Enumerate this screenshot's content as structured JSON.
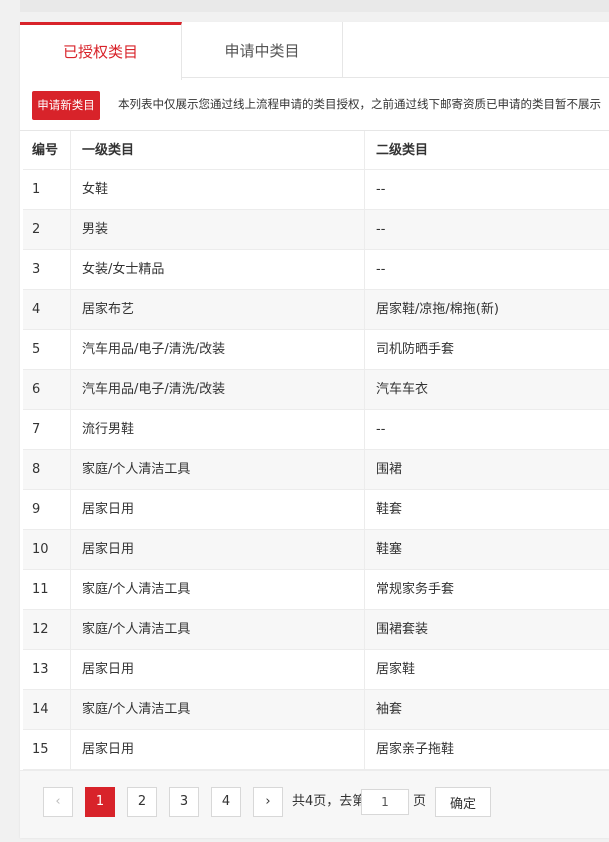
{
  "tabs": {
    "active": "已授权类目",
    "inactive": "申请中类目"
  },
  "notice": {
    "button": "申请新类目",
    "text": "本列表中仅展示您通过线上流程申请的类目授权，之前通过线下邮寄资质已申请的类目暂不展示"
  },
  "table": {
    "headers": [
      "编号",
      "一级类目",
      "二级类目"
    ],
    "rows": [
      {
        "no": "1",
        "level1": "女鞋",
        "level2": "--"
      },
      {
        "no": "2",
        "level1": "男装",
        "level2": "--"
      },
      {
        "no": "3",
        "level1": "女装/女士精品",
        "level2": "--"
      },
      {
        "no": "4",
        "level1": "居家布艺",
        "level2": "居家鞋/凉拖/棉拖(新)"
      },
      {
        "no": "5",
        "level1": "汽车用品/电子/清洗/改装",
        "level2": "司机防晒手套"
      },
      {
        "no": "6",
        "level1": "汽车用品/电子/清洗/改装",
        "level2": "汽车车衣"
      },
      {
        "no": "7",
        "level1": "流行男鞋",
        "level2": "--"
      },
      {
        "no": "8",
        "level1": "家庭/个人清洁工具",
        "level2": "围裙"
      },
      {
        "no": "9",
        "level1": "居家日用",
        "level2": "鞋套"
      },
      {
        "no": "10",
        "level1": "居家日用",
        "level2": "鞋塞"
      },
      {
        "no": "11",
        "level1": "家庭/个人清洁工具",
        "level2": "常规家务手套"
      },
      {
        "no": "12",
        "level1": "家庭/个人清洁工具",
        "level2": "围裙套装"
      },
      {
        "no": "13",
        "level1": "居家日用",
        "level2": "居家鞋"
      },
      {
        "no": "14",
        "level1": "家庭/个人清洁工具",
        "level2": "袖套"
      },
      {
        "no": "15",
        "level1": "居家日用",
        "level2": "居家亲子拖鞋"
      }
    ]
  },
  "pagination": {
    "prev": "‹",
    "next": "›",
    "pages": [
      "1",
      "2",
      "3",
      "4"
    ],
    "current": "1",
    "total_text": "共4页，去第",
    "page_suffix": "页",
    "input_value": "1",
    "confirm": "确定"
  },
  "colors": {
    "accent": "#d8232a"
  }
}
